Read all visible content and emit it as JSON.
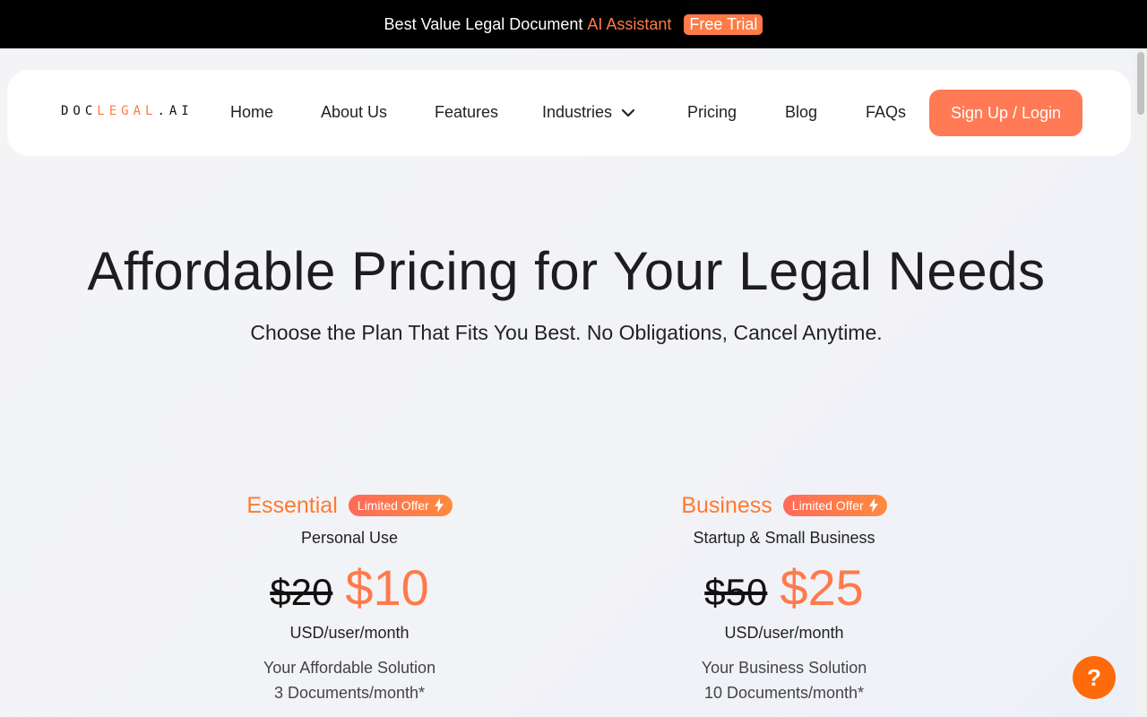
{
  "announcement": {
    "text": "Best Value Legal Document",
    "accent": "AI Assistant",
    "badge": "Free Trial"
  },
  "nav": {
    "logo_prefix": "DOC",
    "logo_mid": "LEGAL",
    "logo_suffix": ".AI",
    "items": [
      "Home",
      "About Us",
      "Features",
      "Industries",
      "Pricing",
      "Blog",
      "FAQs"
    ],
    "cta": "Sign Up / Login"
  },
  "hero": {
    "title": "Affordable Pricing for Your Legal Needs",
    "subtitle": "Choose the Plan That Fits You Best. No Obligations, Cancel Anytime."
  },
  "plans": [
    {
      "name": "Essential",
      "badge": "Limited Offer",
      "audience": "Personal Use",
      "old_price": "$20",
      "price": "$10",
      "unit": "USD/user/month",
      "tagline": "Your Affordable Solution",
      "docs": "3 Documents/month*"
    },
    {
      "name": "Business",
      "badge": "Limited Offer",
      "audience": "Startup & Small Business",
      "old_price": "$50",
      "price": "$25",
      "unit": "USD/user/month",
      "tagline": "Your Business Solution",
      "docs": "10 Documents/month*"
    }
  ],
  "help": {
    "label": "?"
  },
  "colors": {
    "accent": "#ff7a45",
    "help": "#ff6a0a"
  }
}
